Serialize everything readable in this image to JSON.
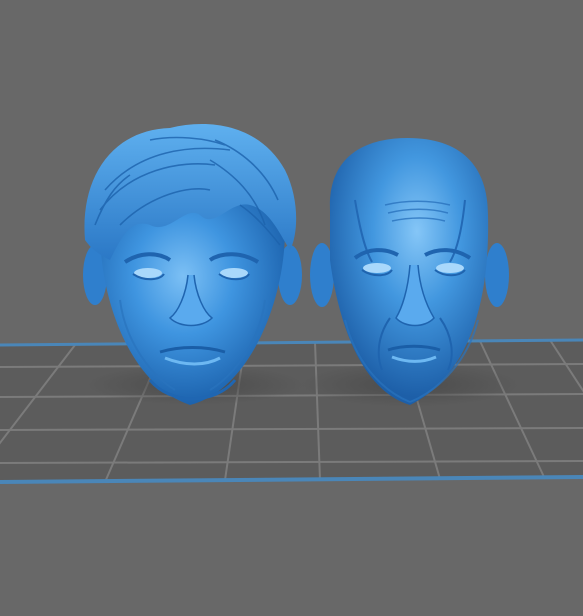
{
  "viewer": {
    "background_color": "#686868",
    "build_plate_color": "#5a5a5a",
    "grid_line_color": "#7a7a7a",
    "plate_edge_color": "#4a86b8",
    "model_color": "#3e8fd8"
  },
  "models": [
    {
      "name": "head-with-hair"
    },
    {
      "name": "bald-head"
    }
  ]
}
